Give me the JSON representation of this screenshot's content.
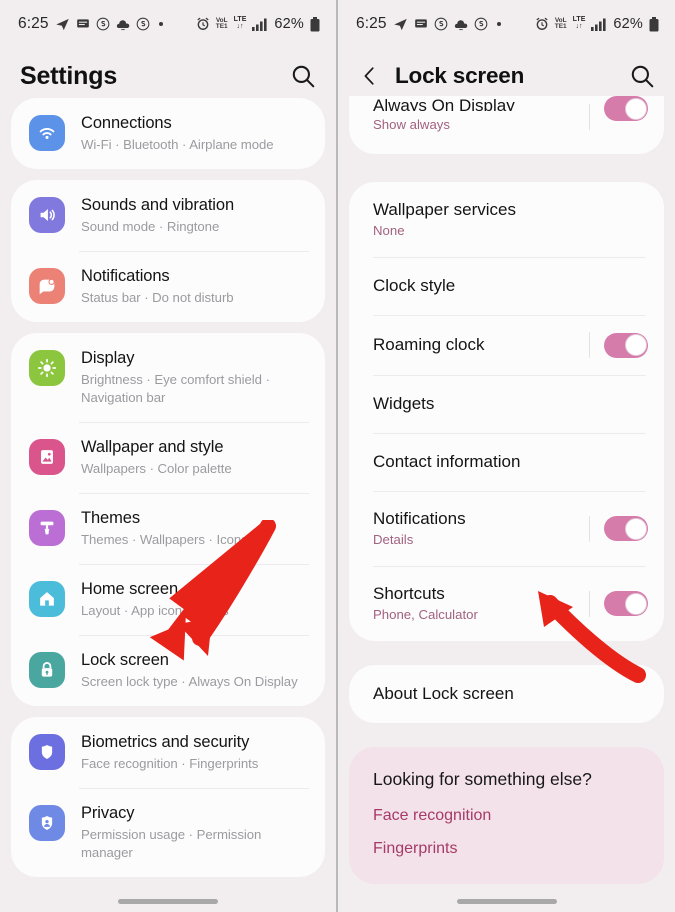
{
  "status_bar": {
    "time": "6:25",
    "left_icons": [
      "telegram-icon",
      "message-icon",
      "circle-s-icon",
      "cloud-upload-icon",
      "circle-s-icon",
      "dot-icon"
    ],
    "volte_label": "VoLTE1",
    "network_label": "LTE",
    "battery_percent": "62%"
  },
  "left_screen": {
    "appbar": {
      "title": "Settings",
      "search": "search-icon"
    },
    "groups": [
      {
        "items": [
          {
            "title": "Connections",
            "subtitle": "Wi-Fi  ·  Bluetooth  ·  Airplane mode",
            "icon": "wifi-icon",
            "color": "#5c92e8"
          }
        ]
      },
      {
        "items": [
          {
            "title": "Sounds and vibration",
            "subtitle": "Sound mode  ·  Ringtone",
            "icon": "speaker-icon",
            "color": "#8179dd"
          },
          {
            "title": "Notifications",
            "subtitle": "Status bar  ·  Do not disturb",
            "icon": "notification-bubble-icon",
            "color": "#ec8275"
          }
        ]
      },
      {
        "items": [
          {
            "title": "Display",
            "subtitle": "Brightness  ·  Eye comfort shield  ·  Navigation bar",
            "icon": "brightness-icon",
            "color": "#8cc63e"
          },
          {
            "title": "Wallpaper and style",
            "subtitle": "Wallpapers  ·  Color palette",
            "icon": "image-icon",
            "color": "#d9558c"
          },
          {
            "title": "Themes",
            "subtitle": "Themes  ·  Wallpapers  ·  Icons",
            "icon": "paint-roller-icon",
            "color": "#bb6fd4"
          },
          {
            "title": "Home screen",
            "subtitle": "Layout  ·  App icon badges",
            "icon": "home-icon",
            "color": "#4cbcdb"
          },
          {
            "title": "Lock screen",
            "subtitle": "Screen lock type  ·  Always On Display",
            "icon": "lock-icon",
            "color": "#4aa7a0"
          }
        ]
      },
      {
        "items": [
          {
            "title": "Biometrics and security",
            "subtitle": "Face recognition  ·  Fingerprints",
            "icon": "shield-icon",
            "color": "#6c6fe0"
          },
          {
            "title": "Privacy",
            "subtitle": "Permission usage  ·  Permission manager",
            "icon": "privacy-person-icon",
            "color": "#6f8ae5"
          }
        ]
      }
    ]
  },
  "right_screen": {
    "appbar": {
      "back": "back-arrow-icon",
      "title": "Lock screen",
      "search": "search-icon"
    },
    "clipped_item": {
      "title": "Always On Display",
      "subtitle": "Show always",
      "toggle": "on"
    },
    "groups": [
      {
        "items": [
          {
            "title": "Wallpaper services",
            "subtitle": "None",
            "toggle": null
          },
          {
            "title": "Clock style",
            "subtitle": null,
            "toggle": null
          },
          {
            "title": "Roaming clock",
            "subtitle": null,
            "toggle": "on"
          },
          {
            "title": "Widgets",
            "subtitle": null,
            "toggle": null
          },
          {
            "title": "Contact information",
            "subtitle": null,
            "toggle": null
          },
          {
            "title": "Notifications",
            "subtitle": "Details",
            "toggle": "on"
          },
          {
            "title": "Shortcuts",
            "subtitle": "Phone, Calculator",
            "toggle": "on"
          }
        ]
      },
      {
        "items": [
          {
            "title": "About Lock screen",
            "subtitle": null,
            "toggle": null
          }
        ]
      }
    ],
    "promo": {
      "heading": "Looking for something else?",
      "links": [
        "Face recognition",
        "Fingerprints"
      ]
    }
  },
  "annotations": {
    "arrow_color": "#e8231a",
    "left_arrow_target": "Lock screen",
    "right_arrow_target": "Shortcuts"
  }
}
